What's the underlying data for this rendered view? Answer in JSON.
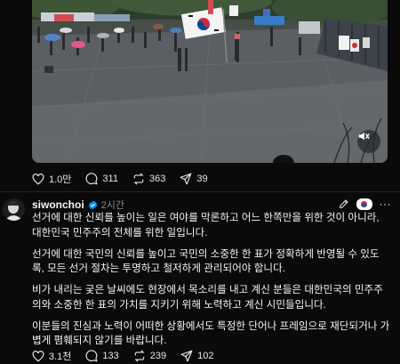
{
  "media": {
    "type": "video",
    "mute_icon": "speaker-muted-icon"
  },
  "post_actions": {
    "likes": "1.0만",
    "comments": "311",
    "reposts": "363",
    "shares": "39"
  },
  "reply": {
    "username": "siwonchoi",
    "verified": true,
    "time": "2시간",
    "icons": [
      "edit-icon",
      "flag-badge-icon",
      "more-icon"
    ],
    "more_label": "···",
    "paragraphs": [
      "선거에 대한 신뢰를 높이는 일은 여야를 막론하고 어느 한쪽만을 위한 것이 아니라, 대한민국 민주주의 전체를 위한 일입니다.",
      "선거에 대한 국민의 신뢰를 높이고 국민의 소중한 한 표가 정확하게 반영될 수 있도록, 모든 선거 절차는 투명하고 철저하게 관리되어야 합니다.",
      "비가 내리는 궂은 날씨에도 현장에서 목소리를 내고 계신 분들은 대한민국의 민주주의와 소중한 한 표의 가치를 지키기 위해 노력하고 계신 시민들입니다.",
      "이분들의 진심과 노력이 어떠한 상황에서도 특정한 단어나 프레임으로 재단되거나 가볍게 폄훼되지 않기를 바랍니다."
    ],
    "actions": {
      "likes": "3.1천",
      "comments": "133",
      "reposts": "239",
      "shares": "102"
    }
  },
  "colors": {
    "background": "#0a0a0a",
    "text": "#f3f5f7",
    "muted": "#8a8a8a",
    "verified": "#0095f6"
  }
}
